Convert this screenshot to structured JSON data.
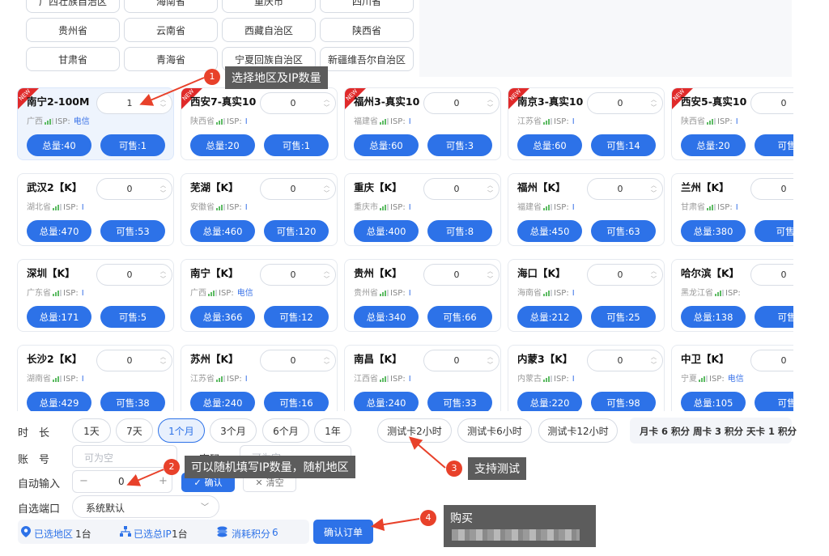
{
  "regions": [
    "广西壮族自治区",
    "海南省",
    "重庆市",
    "四川省",
    "贵州省",
    "云南省",
    "西藏自治区",
    "陕西省",
    "甘肃省",
    "青海省",
    "宁夏回族自治区",
    "新疆维吾尔自治区"
  ],
  "isp_label": "ISP:",
  "cards": [
    {
      "name": "南宁2-100M",
      "province": "广西",
      "isp": "电信",
      "qty": "1",
      "total": "总量:40",
      "sale": "可售:1",
      "new": true,
      "selected": true
    },
    {
      "name": "西安7-真实10",
      "province": "陕西省",
      "isp": "I",
      "qty": "0",
      "total": "总量:20",
      "sale": "可售:1",
      "new": true
    },
    {
      "name": "福州3-真实10",
      "province": "福建省",
      "isp": "I",
      "qty": "0",
      "total": "总量:60",
      "sale": "可售:3",
      "new": true
    },
    {
      "name": "南京3-真实10",
      "province": "江苏省",
      "isp": "I",
      "qty": "0",
      "total": "总量:60",
      "sale": "可售:14",
      "new": true
    },
    {
      "name": "西安5-真实10",
      "province": "陕西省",
      "isp": "I",
      "qty": "0",
      "total": "总量:20",
      "sale": "可售",
      "new": true
    },
    {
      "name": "武汉2【K】",
      "province": "湖北省",
      "isp": "I",
      "qty": "0",
      "total": "总量:470",
      "sale": "可售:53"
    },
    {
      "name": "芜湖【K】",
      "province": "安徽省",
      "isp": "I",
      "qty": "0",
      "total": "总量:460",
      "sale": "可售:120"
    },
    {
      "name": "重庆【K】",
      "province": "重庆市",
      "isp": "I",
      "qty": "0",
      "total": "总量:400",
      "sale": "可售:8"
    },
    {
      "name": "福州【K】",
      "province": "福建省",
      "isp": "I",
      "qty": "0",
      "total": "总量:450",
      "sale": "可售:63"
    },
    {
      "name": "兰州【K】",
      "province": "甘肃省",
      "isp": "I",
      "qty": "0",
      "total": "总量:380",
      "sale": "可售:"
    },
    {
      "name": "深圳【K】",
      "province": "广东省",
      "isp": "I",
      "qty": "0",
      "total": "总量:171",
      "sale": "可售:5"
    },
    {
      "name": "南宁【K】",
      "province": "广西",
      "isp": "电信",
      "qty": "0",
      "total": "总量:366",
      "sale": "可售:12"
    },
    {
      "name": "贵州【K】",
      "province": "贵州省",
      "isp": "I",
      "qty": "0",
      "total": "总量:340",
      "sale": "可售:66"
    },
    {
      "name": "海口【K】",
      "province": "海南省",
      "isp": "I",
      "qty": "0",
      "total": "总量:212",
      "sale": "可售:25"
    },
    {
      "name": "哈尔滨【K】",
      "province": "黑龙江省",
      "isp": "",
      "qty": "0",
      "total": "总量:138",
      "sale": "可售"
    },
    {
      "name": "长沙2【K】",
      "province": "湖南省",
      "isp": "I",
      "qty": "0",
      "total": "总量:429",
      "sale": "可售:38"
    },
    {
      "name": "苏州【K】",
      "province": "江苏省",
      "isp": "I",
      "qty": "0",
      "total": "总量:240",
      "sale": "可售:16"
    },
    {
      "name": "南昌【K】",
      "province": "江西省",
      "isp": "I",
      "qty": "0",
      "total": "总量:240",
      "sale": "可售:33"
    },
    {
      "name": "内蒙3【K】",
      "province": "内蒙古",
      "isp": "I",
      "qty": "0",
      "total": "总量:220",
      "sale": "可售:98"
    },
    {
      "name": "中卫【K】",
      "province": "宁夏",
      "isp": "电信",
      "qty": "0",
      "total": "总量:105",
      "sale": "可售"
    }
  ],
  "form": {
    "duration_label": "时　长",
    "durations": [
      "1天",
      "7天",
      "1个月",
      "3个月",
      "6个月",
      "1年"
    ],
    "tests": [
      "测试卡2小时",
      "测试卡6小时",
      "测试卡12小时"
    ],
    "points_note": "月卡 6 积分 周卡 3 积分 天卡 1 积分",
    "account_label": "账　号",
    "account_placeholder": "可为空",
    "password_label": "密码",
    "password_placeholder": "可为空",
    "auto_label": "自动输入",
    "auto_minus": "−",
    "auto_value": "0",
    "auto_plus": "+",
    "confirm_label": "确认",
    "clear_label": "清空",
    "port_label": "自选端口",
    "port_value": "系统默认"
  },
  "footer": {
    "regions_label": "已选地区",
    "regions_count": "1台",
    "ip_label": "已选总IP",
    "ip_count": "1台",
    "points_label": "消耗积分",
    "points_value": "6",
    "order_button": "确认订单"
  },
  "annotations": [
    {
      "num": "1",
      "text": "选择地区及IP数量"
    },
    {
      "num": "2",
      "text": "可以随机填写IP数量，随机地区"
    },
    {
      "num": "3",
      "text": "支持测试"
    },
    {
      "num": "4",
      "text": "购买"
    }
  ],
  "colors": {
    "accent": "#2d72e8",
    "badge": "#e8412a",
    "annotation_bg": "#5c5c5c",
    "new_tag": "#e02a2a"
  }
}
